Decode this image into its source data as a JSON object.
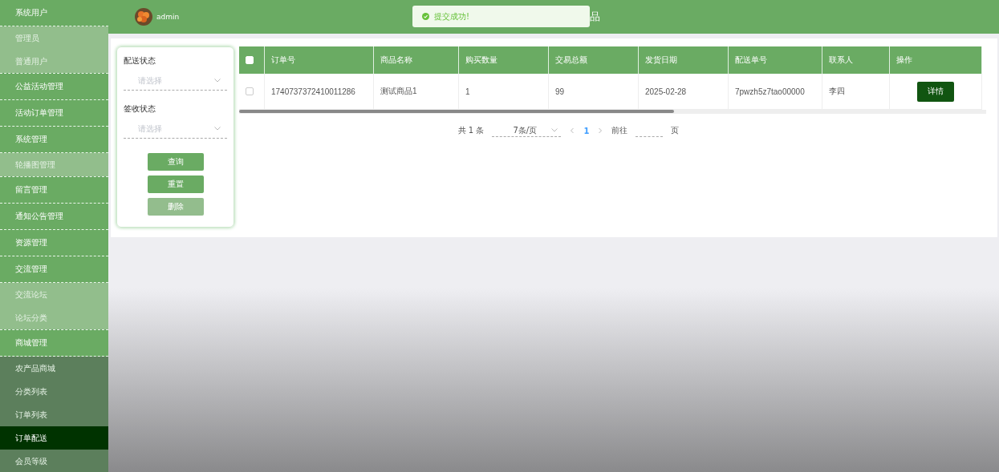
{
  "sidebar": {
    "items": [
      {
        "label": "系统用户",
        "children": [
          {
            "label": "管理员",
            "selected": false
          },
          {
            "label": "普通用户",
            "selected": false
          }
        ]
      },
      {
        "label": "公益活动管理"
      },
      {
        "label": "活动订单管理"
      },
      {
        "label": "系统管理",
        "children": [
          {
            "label": "轮播图管理",
            "selected": false
          }
        ]
      },
      {
        "label": "留言管理"
      },
      {
        "label": "通知公告管理"
      },
      {
        "label": "资源管理"
      },
      {
        "label": "交流管理",
        "children": [
          {
            "label": "交流论坛",
            "selected": false
          },
          {
            "label": "论坛分类",
            "selected": false
          }
        ]
      },
      {
        "label": "商城管理",
        "children": [
          {
            "label": "农产品商城",
            "selected": false
          },
          {
            "label": "分类列表",
            "selected": false
          },
          {
            "label": "订单列表",
            "selected": false
          },
          {
            "label": "订单配送",
            "selected": true
          },
          {
            "label": "会员等级",
            "selected": false
          }
        ]
      }
    ]
  },
  "header": {
    "user": "admin",
    "title": "品"
  },
  "toast": {
    "message": "提交成功!"
  },
  "filters": [
    {
      "label": "配送状态",
      "placeholder": "请选择"
    },
    {
      "label": "签收状态",
      "placeholder": "请选择"
    }
  ],
  "filter_buttons": [
    {
      "label": "查询",
      "disabled": false
    },
    {
      "label": "重置",
      "disabled": false
    },
    {
      "label": "删除",
      "disabled": true
    }
  ],
  "table": {
    "header_checked": false,
    "columns": [
      "订单号",
      "商品名称",
      "购买数量",
      "交易总额",
      "发货日期",
      "配送单号",
      "联系人",
      "操作"
    ],
    "rows": [
      {
        "checked": false,
        "cells": [
          "1740737372410011286",
          "测试商品1",
          "1",
          "99",
          "2025-02-28",
          "7pwzh5z7tao00000",
          "李四"
        ],
        "action": "详情"
      }
    ]
  },
  "pagination": {
    "total": "共 1 条",
    "page_size": "7条/页",
    "pages": [
      {
        "label": "1",
        "selected": true
      }
    ],
    "goto_label": "前往",
    "goto_suffix": "页"
  }
}
